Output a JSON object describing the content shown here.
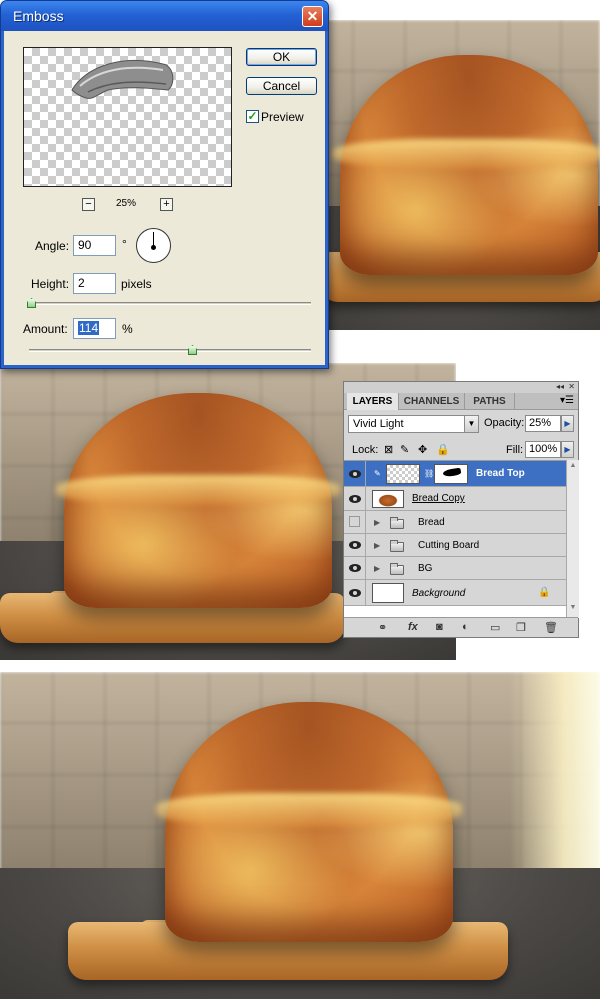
{
  "emboss_dialog": {
    "title": "Emboss",
    "close_glyph": "✕",
    "ok_label": "OK",
    "cancel_label": "Cancel",
    "preview_label": "Preview",
    "preview_checked": true,
    "zoom_out_glyph": "−",
    "zoom_in_glyph": "+",
    "zoom_level": "25%",
    "angle_label": "Angle:",
    "angle_value": "90",
    "angle_unit": "°",
    "height_label": "Height:",
    "height_value": "2",
    "height_unit": "pixels",
    "amount_label": "Amount:",
    "amount_value": "114",
    "amount_unit": "%",
    "height_slider_fraction": 0.02,
    "amount_slider_fraction": 0.58
  },
  "layers_panel": {
    "tabs": [
      {
        "label": "LAYERS",
        "active": true
      },
      {
        "label": "CHANNELS",
        "active": false
      },
      {
        "label": "PATHS",
        "active": false
      }
    ],
    "blend_mode": "Vivid Light",
    "opacity_label": "Opacity:",
    "opacity_value": "25%",
    "lock_label": "Lock:",
    "fill_label": "Fill:",
    "fill_value": "100%",
    "layers": [
      {
        "name": "Bread Top",
        "visible": true,
        "selected": true,
        "type": "layer-with-mask"
      },
      {
        "name": "Bread Copy",
        "visible": true,
        "selected": false,
        "type": "layer"
      },
      {
        "name": "Bread",
        "visible": false,
        "selected": false,
        "type": "group"
      },
      {
        "name": "Cutting Board",
        "visible": true,
        "selected": false,
        "type": "group"
      },
      {
        "name": "BG",
        "visible": true,
        "selected": false,
        "type": "group"
      },
      {
        "name": "Background",
        "visible": true,
        "selected": false,
        "type": "background",
        "locked": true
      }
    ],
    "footer_icons": [
      "link-icon",
      "fx-icon",
      "mask-icon",
      "adjustment-icon",
      "new-group-icon",
      "new-layer-icon",
      "trash-icon"
    ],
    "footer_glyphs": {
      "link": "⚭",
      "fx": "fx",
      "mask": "◙",
      "adjust": "◐",
      "group": "▭",
      "new": "❐",
      "trash": "🗑"
    }
  },
  "colors": {
    "title_bar_blue": "#2462d4",
    "selected_layer_blue": "#3d6fc2",
    "dialog_face": "#ece9d8"
  }
}
